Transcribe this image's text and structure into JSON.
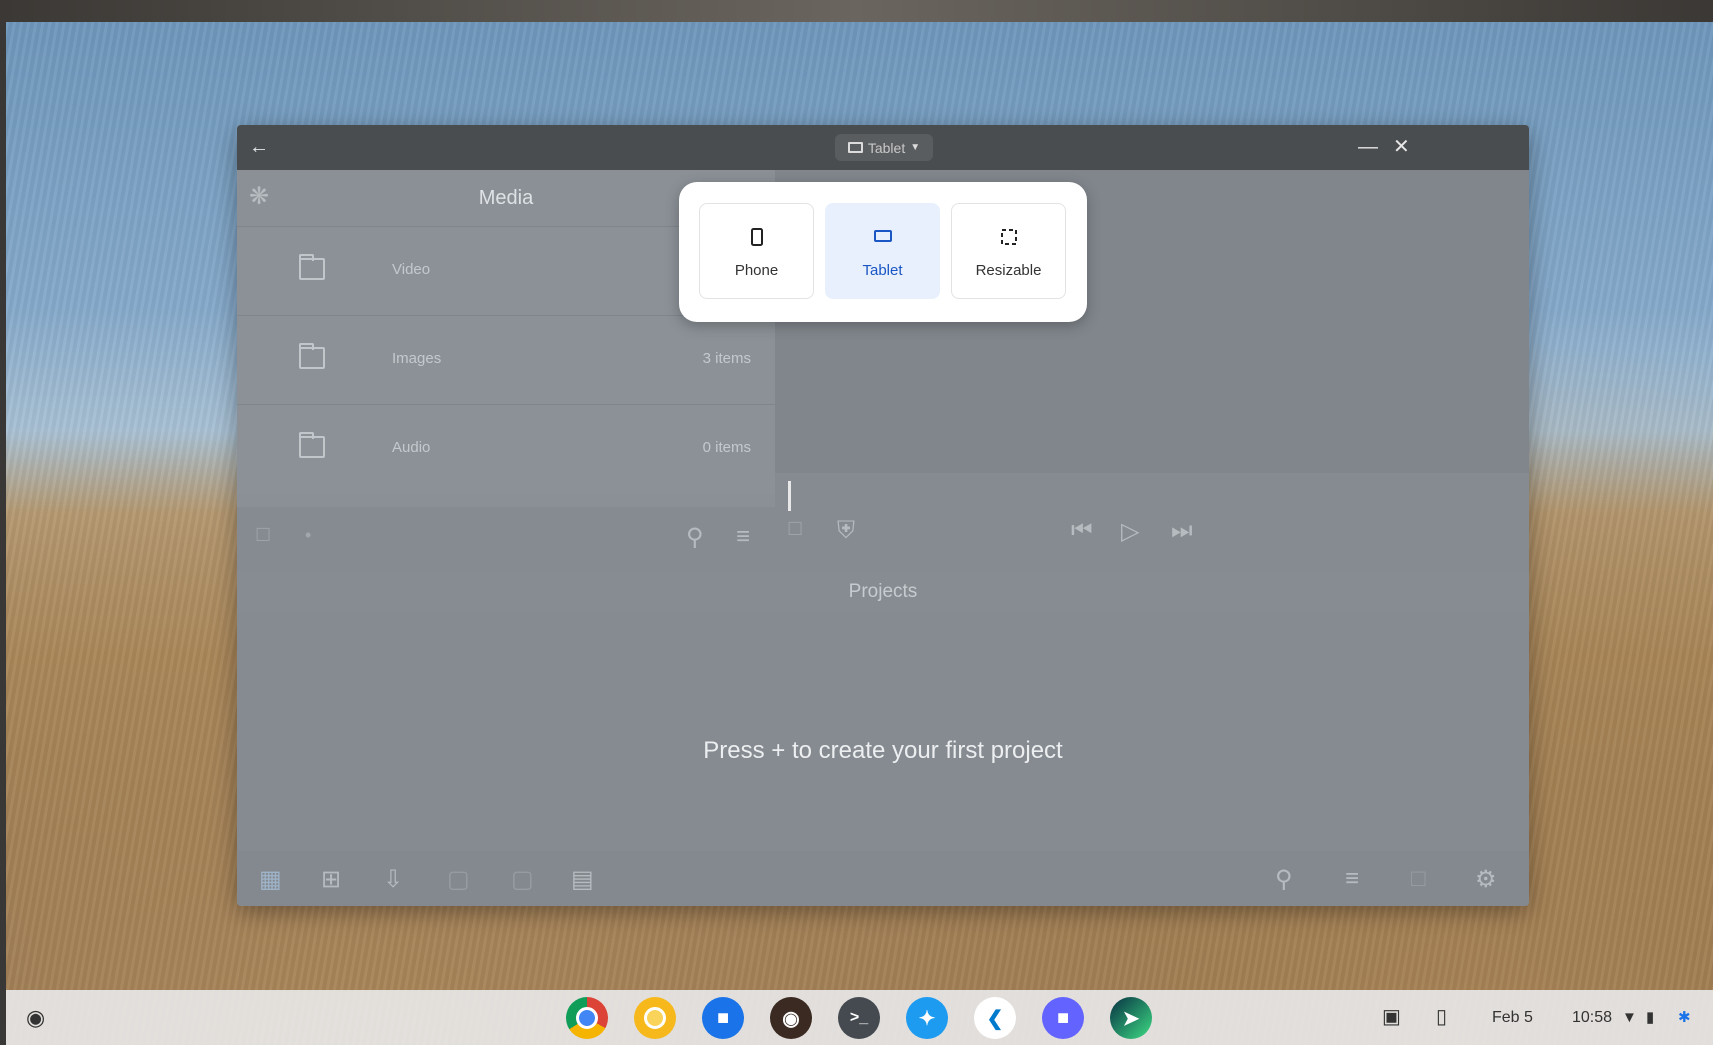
{
  "window": {
    "mode_label": "Tablet",
    "colors": {
      "selected_option": "#1a56c4",
      "selected_bg": "#e7f0fc"
    }
  },
  "media": {
    "title": "Media",
    "rows": [
      {
        "name": "Video",
        "count": ""
      },
      {
        "name": "Images",
        "count": "3 items"
      },
      {
        "name": "Audio",
        "count": "0 items"
      }
    ]
  },
  "projects": {
    "label": "Projects",
    "empty_message": "Press + to create your first project"
  },
  "size_popup": {
    "options": [
      {
        "label": "Phone",
        "selected": false
      },
      {
        "label": "Tablet",
        "selected": true
      },
      {
        "label": "Resizable",
        "selected": false
      }
    ]
  },
  "shelf": {
    "apps": [
      "chrome-icon",
      "chrome-canary-icon",
      "files-icon",
      "terminal-app-icon",
      "terminal-icon",
      "twitter-icon",
      "vscode-icon",
      "mastodon-icon",
      "android-studio-icon"
    ],
    "date": "Feb 5",
    "time": "10:58"
  }
}
